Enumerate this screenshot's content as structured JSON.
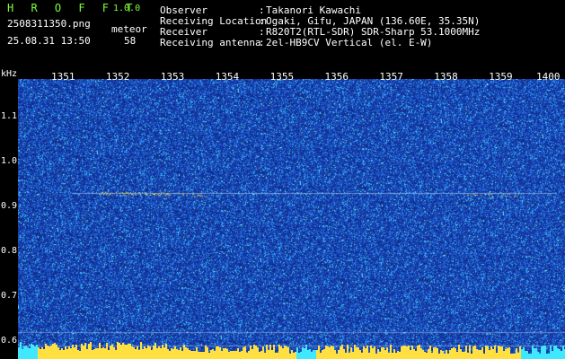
{
  "header": {
    "app_title": "H R O F F T",
    "app_version": "1.0.0",
    "file_name": "2508311350.png",
    "meteor_label": "meteor",
    "timestamp": "25.08.31 13:50",
    "meteor_count": "58",
    "info": [
      {
        "label": "Observer",
        "value": "Takanori Kawachi"
      },
      {
        "label": "Receiving Location",
        "value": "Ogaki, Gifu, JAPAN (136.60E, 35.35N)"
      },
      {
        "label": "Receiver",
        "value": "R820T2(RTL-SDR) SDR-Sharp 53.1000MHz"
      },
      {
        "label": "Receiving antenna",
        "value": "2el-HB9CV Vertical (el. E-W)"
      }
    ],
    "separator": ":"
  },
  "colors": {
    "background": "#102c8c",
    "noise_low": "#1a3aa8",
    "noise_mid": "#2a8cff",
    "noise_high": "#40e8ff",
    "echo": "#ffe040",
    "text_accent": "#7cff3a"
  },
  "chart_data": {
    "type": "heatmap",
    "xlabel": "",
    "ylabel": "kHz",
    "x_ticks": [
      "1351",
      "1352",
      "1353",
      "1354",
      "1355",
      "1356",
      "1357",
      "1358",
      "1359",
      "1400"
    ],
    "y_ticks": [
      "1.1",
      "1.0",
      "0.9",
      "0.8",
      "0.7",
      "0.6"
    ],
    "ylim": [
      0.58,
      1.18
    ],
    "carrier_khz": 0.93,
    "grid": false
  }
}
